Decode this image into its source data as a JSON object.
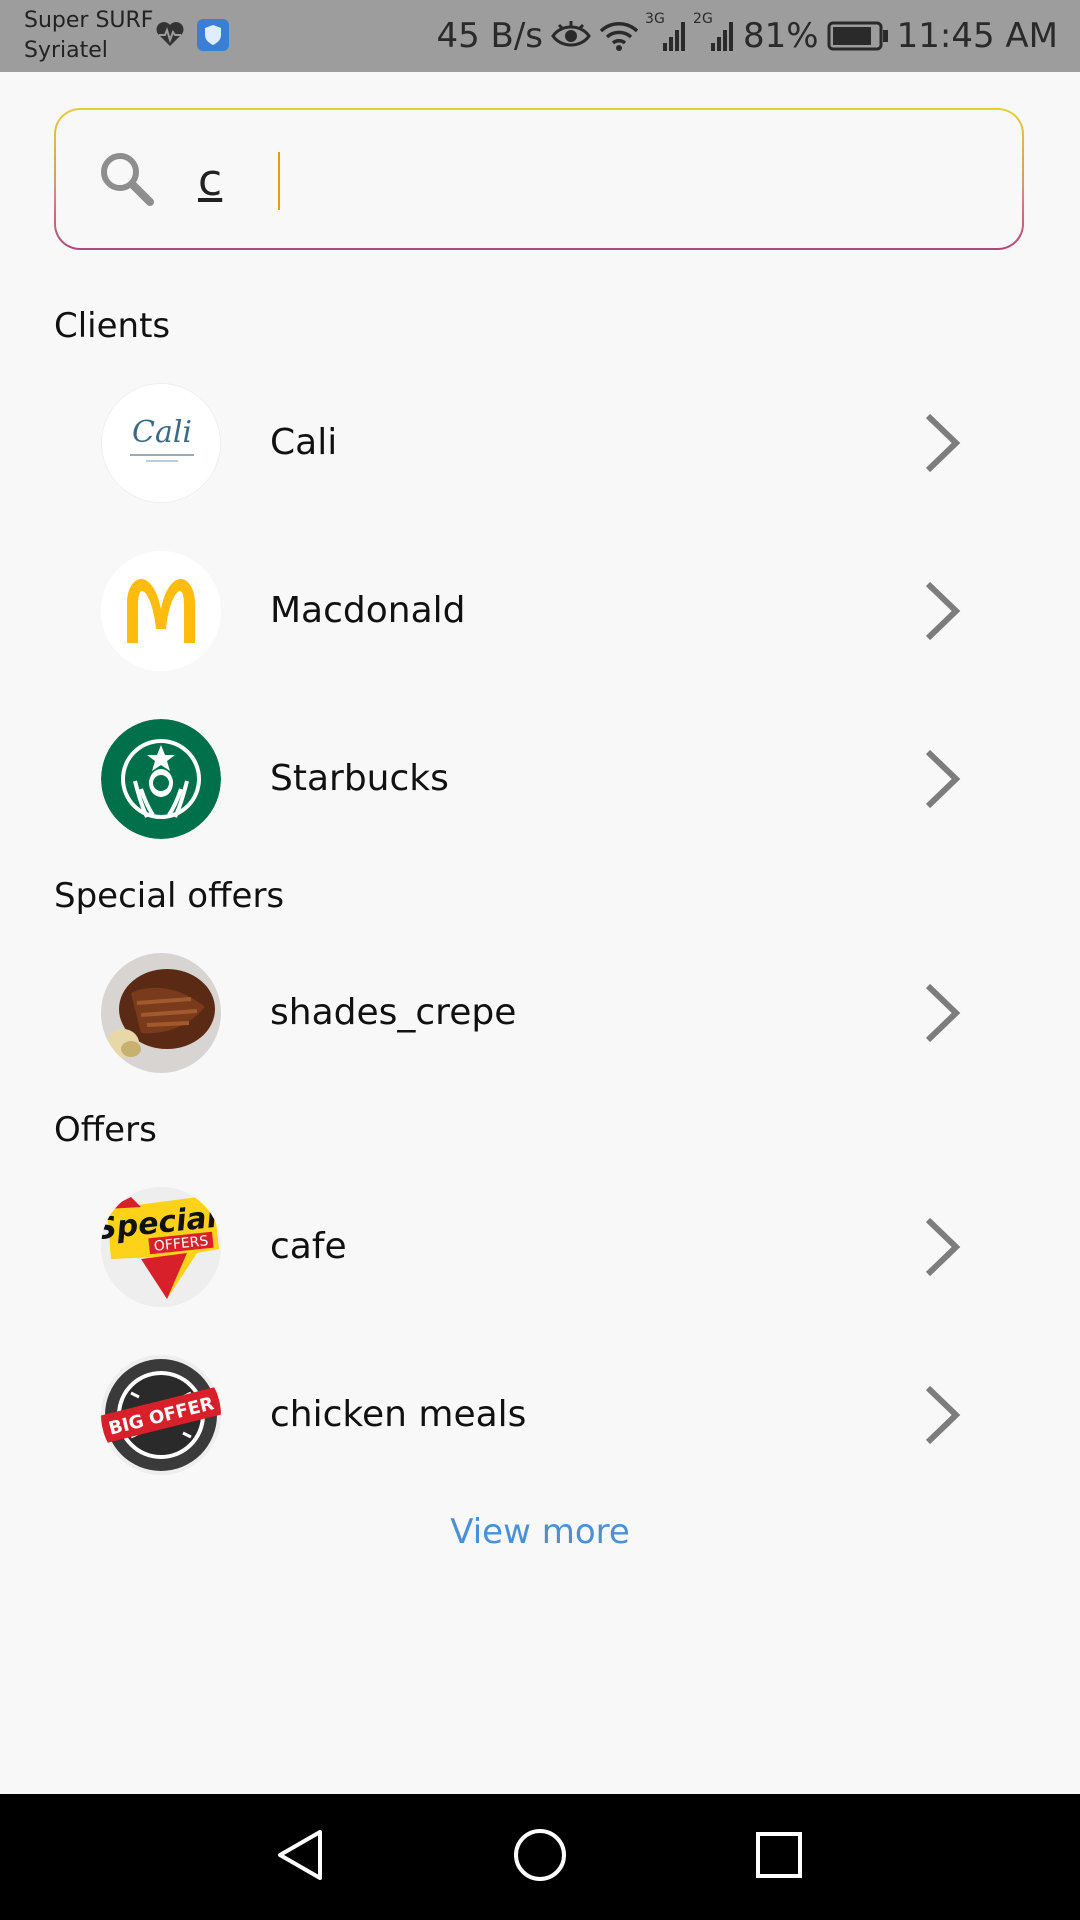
{
  "status_bar": {
    "carrier_line1": "Super SURF",
    "carrier_line2": "Syriatel",
    "net_speed": "45 B/s",
    "sim1_type": "3G",
    "sim2_type": "2G",
    "battery": "81%",
    "time": "11:45 AM",
    "icons": [
      "heartbeat-icon",
      "shield-icon",
      "eye-icon",
      "wifi-icon",
      "signal-icon",
      "battery-icon"
    ]
  },
  "search": {
    "value": "c",
    "icon": "search-icon",
    "accent_colors": [
      "#e6cf3a",
      "#b3467c"
    ]
  },
  "sections": {
    "clients_title": "Clients",
    "special_offers_title": "Special offers",
    "offers_title": "Offers"
  },
  "clients": [
    {
      "label": "Cali",
      "logo_text": "Cali"
    },
    {
      "label": "Macdonald"
    },
    {
      "label": "Starbucks"
    }
  ],
  "special_offers": [
    {
      "label": "shades_crepe"
    }
  ],
  "offers": [
    {
      "label": "cafe",
      "logo_text": "Special",
      "logo_subtext": "OFFERS"
    },
    {
      "label": "chicken meals",
      "logo_text": "BIG OFFER",
      "logo_ring_text": "BIG OFFER"
    }
  ],
  "view_more_label": "View more",
  "colors": {
    "link": "#4a90d9",
    "starbucks_green": "#00704a",
    "mcdonalds_yellow": "#ffbc0d"
  },
  "nav_bar": {
    "icons": [
      "back-icon",
      "home-icon",
      "recents-icon"
    ]
  }
}
